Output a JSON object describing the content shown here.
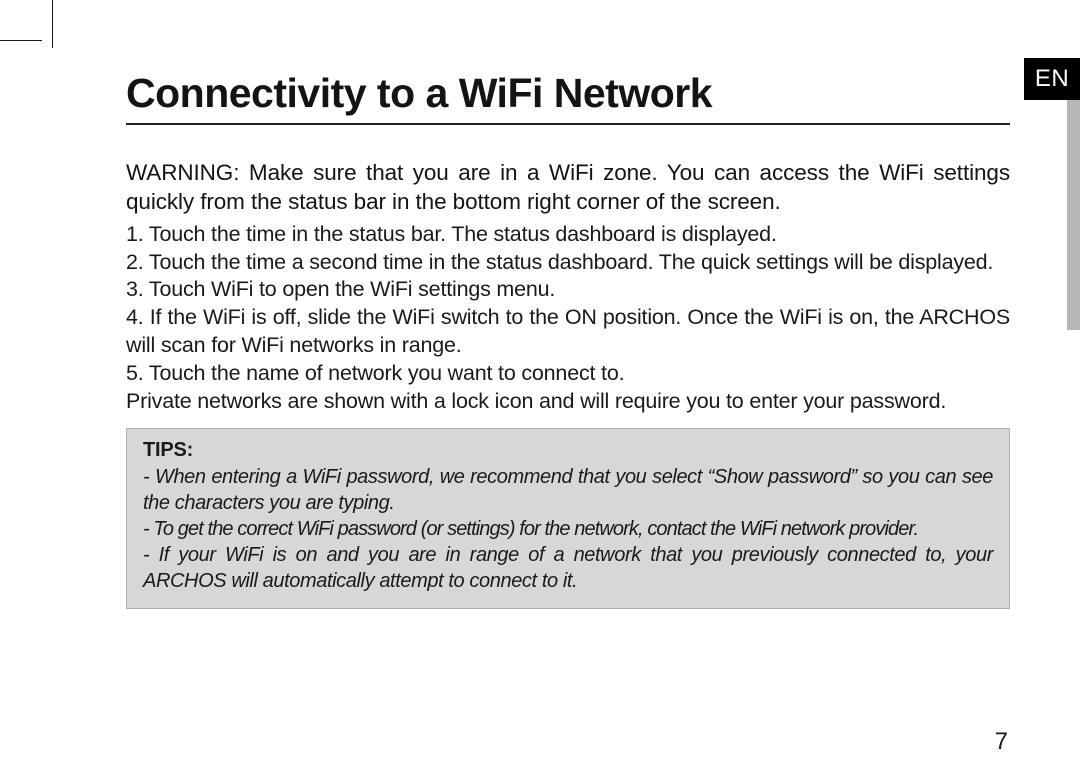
{
  "language_tab": "EN",
  "title": "Connectivity to a WiFi Network",
  "warning": "WARNING:  Make sure that you are in a WiFi zone. You can access the WiFi settings quickly from the status bar in the bottom right corner of the screen.",
  "steps": [
    "1. Touch the time in the status bar. The status dashboard is displayed.",
    "2. Touch the time a second time in the status dashboard. The quick settings will be displayed.",
    "3. Touch WiFi to open the WiFi settings menu.",
    "4. If the WiFi is off, slide the WiFi switch to the ON position. Once the WiFi is on, the ARCHOS will scan for WiFi networks in range.",
    "5. Touch the name of network you want to connect to.",
    "Private networks are shown with a lock icon and will require you to enter your password."
  ],
  "tips": {
    "heading": "TIPS:",
    "items": [
      "- When entering a WiFi password, we recommend that you select “Show password” so you can see the characters you are typing.",
      "- To get the correct WiFi password (or settings) for the network, contact the WiFi network provider.",
      "- If your WiFi is on and you are in range of a network that you previously connected to, your ARCHOS will automatically attempt to connect to it."
    ]
  },
  "page_number": "7"
}
